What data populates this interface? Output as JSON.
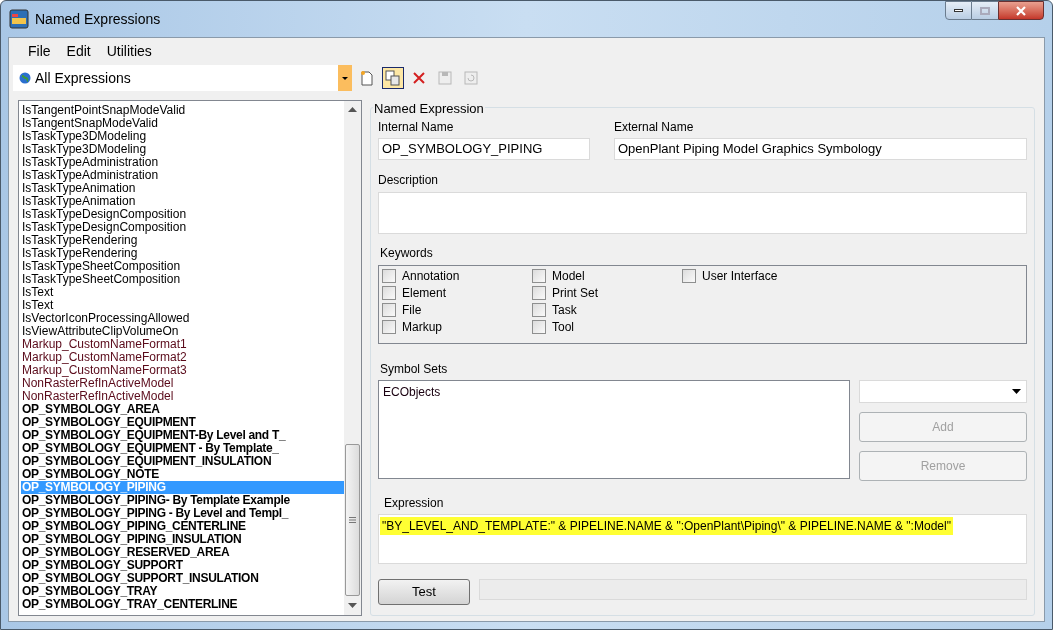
{
  "window": {
    "title": "Named Expressions"
  },
  "menu": [
    "File",
    "Edit",
    "Utilities"
  ],
  "filter": {
    "value": "All Expressions"
  },
  "toolbar": [
    {
      "kind": "new",
      "disabled": false,
      "selected": false
    },
    {
      "kind": "copy",
      "disabled": false,
      "selected": true
    },
    {
      "kind": "delete",
      "disabled": false,
      "selected": false
    },
    {
      "kind": "save",
      "disabled": true,
      "selected": false
    },
    {
      "kind": "refresh",
      "disabled": true,
      "selected": false
    }
  ],
  "expressions": [
    {
      "text": "IsTangentPointSnapModeValid",
      "kind": "system",
      "selected": false
    },
    {
      "text": "IsTangentSnapModeValid",
      "kind": "system",
      "selected": false
    },
    {
      "text": "IsTaskType3DModeling",
      "kind": "system",
      "selected": false
    },
    {
      "text": "IsTaskType3DModeling",
      "kind": "system",
      "selected": false
    },
    {
      "text": "IsTaskTypeAdministration",
      "kind": "system",
      "selected": false
    },
    {
      "text": "IsTaskTypeAdministration",
      "kind": "system",
      "selected": false
    },
    {
      "text": "IsTaskTypeAnimation",
      "kind": "system",
      "selected": false
    },
    {
      "text": "IsTaskTypeAnimation",
      "kind": "system",
      "selected": false
    },
    {
      "text": "IsTaskTypeDesignComposition",
      "kind": "system",
      "selected": false
    },
    {
      "text": "IsTaskTypeDesignComposition",
      "kind": "system",
      "selected": false
    },
    {
      "text": "IsTaskTypeRendering",
      "kind": "system",
      "selected": false
    },
    {
      "text": "IsTaskTypeRendering",
      "kind": "system",
      "selected": false
    },
    {
      "text": "IsTaskTypeSheetComposition",
      "kind": "system",
      "selected": false
    },
    {
      "text": "IsTaskTypeSheetComposition",
      "kind": "system",
      "selected": false
    },
    {
      "text": "IsText",
      "kind": "system",
      "selected": false
    },
    {
      "text": "IsText",
      "kind": "system",
      "selected": false
    },
    {
      "text": "IsVectorIconProcessingAllowed",
      "kind": "system",
      "selected": false
    },
    {
      "text": "IsViewAttributeClipVolumeOn",
      "kind": "system",
      "selected": false
    },
    {
      "text": "Markup_CustomNameFormat1",
      "kind": "library",
      "selected": false
    },
    {
      "text": "Markup_CustomNameFormat2",
      "kind": "library",
      "selected": false
    },
    {
      "text": "Markup_CustomNameFormat3",
      "kind": "library",
      "selected": false
    },
    {
      "text": "NonRasterRefInActiveModel",
      "kind": "library",
      "selected": false
    },
    {
      "text": "NonRasterRefInActiveModel",
      "kind": "library",
      "selected": false
    },
    {
      "text": "OP_SYMBOLOGY_AREA",
      "kind": "user",
      "selected": false
    },
    {
      "text": "OP_SYMBOLOGY_EQUIPMENT",
      "kind": "user",
      "selected": false
    },
    {
      "text": "OP_SYMBOLOGY_EQUIPMENT-By Level and T_",
      "kind": "user",
      "selected": false
    },
    {
      "text": "OP_SYMBOLOGY_EQUIPMENT - By Template_",
      "kind": "user",
      "selected": false
    },
    {
      "text": "OP_SYMBOLOGY_EQUIPMENT_INSULATION",
      "kind": "user",
      "selected": false
    },
    {
      "text": "OP_SYMBOLOGY_NOTE",
      "kind": "user",
      "selected": false
    },
    {
      "text": "OP_SYMBOLOGY_PIPING",
      "kind": "user",
      "selected": true
    },
    {
      "text": "OP_SYMBOLOGY_PIPING- By Template Example",
      "kind": "user",
      "selected": false
    },
    {
      "text": "OP_SYMBOLOGY_PIPING - By Level and Templ_",
      "kind": "user",
      "selected": false
    },
    {
      "text": "OP_SYMBOLOGY_PIPING_CENTERLINE",
      "kind": "user",
      "selected": false
    },
    {
      "text": "OP_SYMBOLOGY_PIPING_INSULATION",
      "kind": "user",
      "selected": false
    },
    {
      "text": "OP_SYMBOLOGY_RESERVED_AREA",
      "kind": "user",
      "selected": false
    },
    {
      "text": "OP_SYMBOLOGY_SUPPORT",
      "kind": "user",
      "selected": false
    },
    {
      "text": "OP_SYMBOLOGY_SUPPORT_INSULATION",
      "kind": "user",
      "selected": false
    },
    {
      "text": "OP_SYMBOLOGY_TRAY",
      "kind": "user",
      "selected": false
    },
    {
      "text": "OP_SYMBOLOGY_TRAY_CENTERLINE",
      "kind": "user",
      "selected": false
    }
  ],
  "details": {
    "group_title": "Named Expression",
    "internal_name": {
      "label": "Internal Name",
      "value": "OP_SYMBOLOGY_PIPING"
    },
    "external_name": {
      "label": "External Name",
      "value": "OpenPlant Piping Model Graphics Symbology"
    },
    "description": {
      "label": "Description"
    },
    "keywords": {
      "label": "Keywords",
      "columns": [
        [
          {
            "label": "Annotation",
            "checked": false
          },
          {
            "label": "Element",
            "checked": false
          },
          {
            "label": "File",
            "checked": false
          },
          {
            "label": "Markup",
            "checked": false
          }
        ],
        [
          {
            "label": "Model",
            "checked": false
          },
          {
            "label": "Print Set",
            "checked": false
          },
          {
            "label": "Task",
            "checked": false
          },
          {
            "label": "Tool",
            "checked": false
          }
        ],
        [
          {
            "label": "User Interface",
            "checked": false
          }
        ]
      ]
    },
    "symbol_sets": {
      "label": "Symbol Sets",
      "items": [
        "ECObjects"
      ],
      "add": {
        "label": "Add",
        "disabled": true
      },
      "remove": {
        "label": "Remove",
        "disabled": true
      }
    },
    "expression": {
      "label": "Expression",
      "value": "\"BY_LEVEL_AND_TEMPLATE:\" & PIPELINE.NAME & \":OpenPlant\\Piping\\\" & PIPELINE.NAME & \":Model\"",
      "highlighted": true
    },
    "test": {
      "label": "Test",
      "disabled": false
    }
  }
}
